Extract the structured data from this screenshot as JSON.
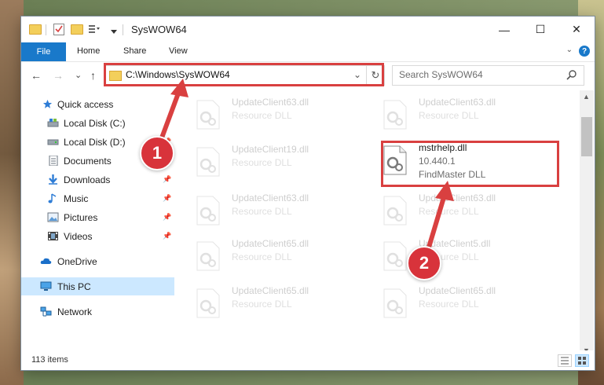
{
  "window": {
    "title": "SysWOW64",
    "minimize_glyph": "—",
    "maximize_glyph": "☐",
    "close_glyph": "✕"
  },
  "ribbon": {
    "file": "File",
    "tabs": [
      "Home",
      "Share",
      "View"
    ],
    "help_glyph": "?",
    "collapse_glyph": "⌄"
  },
  "nav": {
    "back": "←",
    "forward": "→",
    "recent": "⌄",
    "up": "↑",
    "address": "C:\\Windows\\SysWOW64",
    "address_dropdown": "⌄",
    "refresh": "↻",
    "search_placeholder": "Search SysWOW64"
  },
  "sidebar": {
    "items": [
      {
        "label": "Quick access",
        "icon": "star-icon",
        "pinned": false
      },
      {
        "label": "Local Disk (C:)",
        "icon": "drive-icon",
        "pinned": false
      },
      {
        "label": "Local Disk (D:)",
        "icon": "drive-icon",
        "pinned": true
      },
      {
        "label": "Documents",
        "icon": "documents-icon",
        "pinned": true
      },
      {
        "label": "Downloads",
        "icon": "downloads-icon",
        "pinned": true
      },
      {
        "label": "Music",
        "icon": "music-icon",
        "pinned": true
      },
      {
        "label": "Pictures",
        "icon": "pictures-icon",
        "pinned": true
      },
      {
        "label": "Videos",
        "icon": "videos-icon",
        "pinned": true
      },
      {
        "label": "OneDrive",
        "icon": "onedrive-icon",
        "pinned": false
      },
      {
        "label": "This PC",
        "icon": "this-pc-icon",
        "pinned": false,
        "selected": true
      },
      {
        "label": "Network",
        "icon": "network-icon",
        "pinned": false
      }
    ],
    "pin_glyph": "📌"
  },
  "files": [
    {
      "name": "UpdateClient63.dll",
      "line2": "Resource DLL",
      "line3": "",
      "faded": true
    },
    {
      "name": "UpdateClient63.dll",
      "line2": "Resource DLL",
      "line3": "",
      "faded": true
    },
    {
      "name": "UpdateClient19.dll",
      "line2": "Resource DLL",
      "line3": "",
      "faded": true
    },
    {
      "name": "mstrhelp.dll",
      "line2": "10.440.1",
      "line3": "FindMaster DLL",
      "faded": false
    },
    {
      "name": "UpdateClient63.dll",
      "line2": "Resource DLL",
      "line3": "",
      "faded": true
    },
    {
      "name": "UpdateClient63.dll",
      "line2": "Resource DLL",
      "line3": "",
      "faded": true
    },
    {
      "name": "UpdateClient65.dll",
      "line2": "Resource DLL",
      "line3": "",
      "faded": true
    },
    {
      "name": "UpdateClient5.dll",
      "line2": "Resource DLL",
      "line3": "",
      "faded": true
    },
    {
      "name": "UpdateClient65.dll",
      "line2": "Resource DLL",
      "line3": "",
      "faded": true
    },
    {
      "name": "UpdateClient65.dll",
      "line2": "Resource DLL",
      "line3": "",
      "faded": true
    }
  ],
  "status": {
    "count": "113 items"
  },
  "annotations": {
    "step1": "1",
    "step2": "2",
    "color": "#d94040"
  }
}
